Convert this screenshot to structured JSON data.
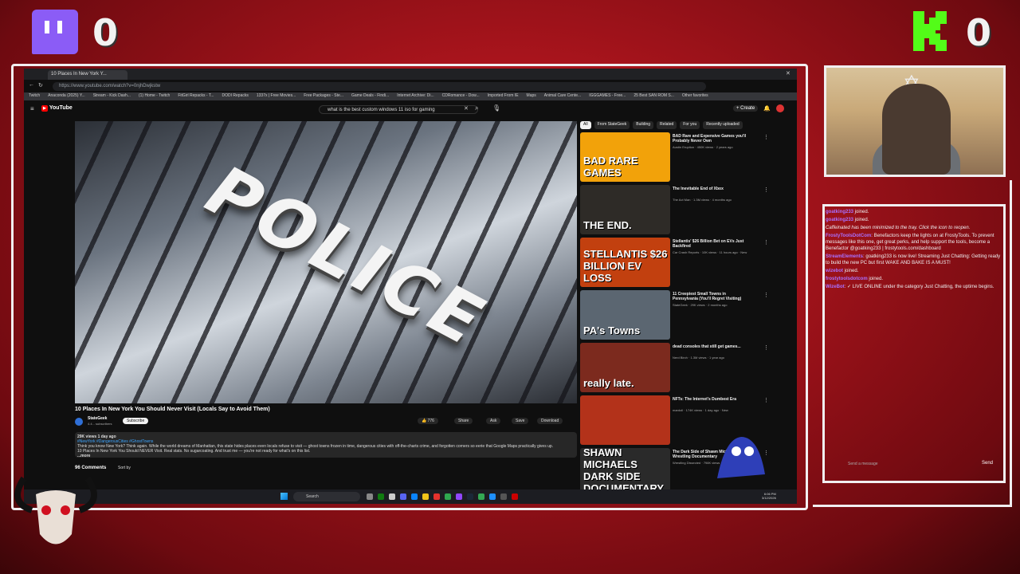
{
  "overlay": {
    "twitch_score": "0",
    "kick_score": "0",
    "colors": {
      "frame": "#f1eef0",
      "background": "#b0151d",
      "twitch": "#8b5cf6",
      "kick": "#53fc18"
    }
  },
  "browser": {
    "tab_title": "10 Places In New York Y...",
    "url": "https://www.youtube.com/watch?v=0njhDwjkstw",
    "bookmarks": [
      "Twitch",
      "Anaconda (2025) Y...",
      "Stream - Kick Dash...",
      "(1) Home - Twitch",
      "FitGirl Repacks - T...",
      "DODI Repacks",
      "1337x | Free Movies...",
      "Free Packages - Ste...",
      "Game Deals - Findi...",
      "Internet Archive: Di...",
      "CDRomance - Dow...",
      "Imported From IE",
      "Maps",
      "Animal Care Cente...",
      "IGGGAMES - Free...",
      "25 Best SAN ROM S...",
      "Other favorites"
    ]
  },
  "youtube": {
    "logo": "YouTube",
    "search_query": "what is the best custom windows 11 iso for gaming",
    "create_label": "+ Create",
    "video_overlay_text": "POLICE",
    "video_title": "10 Places In New York You Should Never Visit (Locals Say to Avoid Them)",
    "channel_name": "StateGeek",
    "subscribers": "4.4... subscribers",
    "subscribe_label": "Subscribe",
    "likes": "776",
    "share_label": "Share",
    "ask_label": "Ask",
    "save_label": "Save",
    "download_label": "Download",
    "views": "29K views  1 day ago",
    "hashtags": "#NewYork #DangerousCities #GhostTowns",
    "description": "Think you know New York? Think again. While the world dreams of Manhattan, this state hides places even locals refuse to visit — ghost towns frozen in time, dangerous cities with off-the-charts crime, and forgotten corners so eerie that Google Maps practically gives up.",
    "description_2": "10 Places In New York You Should NEVER Visit. Real stats. No sugarcoating. And trust me — you're not ready for what's on this list.",
    "more_label": "...more",
    "comments_label": "96 Comments",
    "sort_label": "Sort by",
    "chips": [
      "All",
      "From StateGeek",
      "Building",
      "Related",
      "For you",
      "Recently uploaded"
    ],
    "sidebar": [
      {
        "title": "BAD Rare and Expensive Games you'll Probably Never Own",
        "meta": "Austin Eruption · 450K views · 2 years ago",
        "thumb_text": "BAD RARE GAMES",
        "thumb_color": "#f2a20a"
      },
      {
        "title": "The Inevitable End of Xbox",
        "meta": "The Act Man · 1.3M views · 4 months ago",
        "thumb_text": "THE END.",
        "thumb_color": "#2e2b27"
      },
      {
        "title": "Stellantis' $26 Billion Bet on EVs Just Backfired",
        "meta": "Car Crash Reports · 10K views · 11 hours ago · New",
        "thumb_text": "STELLANTIS $26 BILLION EV LOSS",
        "thumb_color": "#c2400f"
      },
      {
        "title": "11 Creepiest Small Towns in Pennsylvania (You'll Regret Visiting)",
        "meta": "StateGeek · 29K views · 2 months ago",
        "thumb_text": "PA's Towns",
        "thumb_color": "#5b6671"
      },
      {
        "title": "dead consoles that still get games...",
        "meta": "Nerd Birch · 1.3M views · 1 year ago",
        "thumb_text": "really late.",
        "thumb_color": "#7c2a1e"
      },
      {
        "title": "NFTs: The Internet's Dumbest Era",
        "meta": "mardoll · 174K views · 1 day ago · New",
        "thumb_text": "",
        "thumb_color": "#b3321a"
      },
      {
        "title": "The Dark Side of Shawn Michaels' Wrestling Documentary",
        "meta": "Wrestling Dissected · 798K views · 18 hours ago",
        "thumb_text": "SHAWN MICHAELS DARK SIDE DOCUMENTARY",
        "thumb_color": "#2a2a2a"
      }
    ]
  },
  "taskbar": {
    "search_placeholder": "Search",
    "time": "6:06 PM",
    "date": "3/12/2026"
  },
  "chat": {
    "messages": [
      {
        "user": "goatking233",
        "text": " joined."
      },
      {
        "user": "goatking233",
        "text": " joined."
      },
      {
        "user": "",
        "text": "Caffeinated has been minimized to the tray. Click the icon to reopen."
      },
      {
        "user": "FrostyToolsDotCom",
        "text": ": Benefactors keep the lights on at FrostyTools. To prevent messages like this one, get great perks, and help support the tools, become a Benefactor @goatking233 | frostytools.com/dashboard"
      },
      {
        "user": "StreamElements",
        "text": ": goatking233 is now live! Streaming Just Chatting: Getting ready to build the new PC but first WAKE AND BAKE IS A MUST!"
      },
      {
        "user": "wizebot",
        "text": " joined."
      },
      {
        "user": "frostytoolsdotcom",
        "text": " joined."
      },
      {
        "user": "WizeBot",
        "text": ": ✓ LIVE ONLINE under the category Just Chatting, the uptime begins."
      }
    ],
    "placeholder": "Send a message",
    "send_label": "Send",
    "username_color": "#a970ff"
  }
}
